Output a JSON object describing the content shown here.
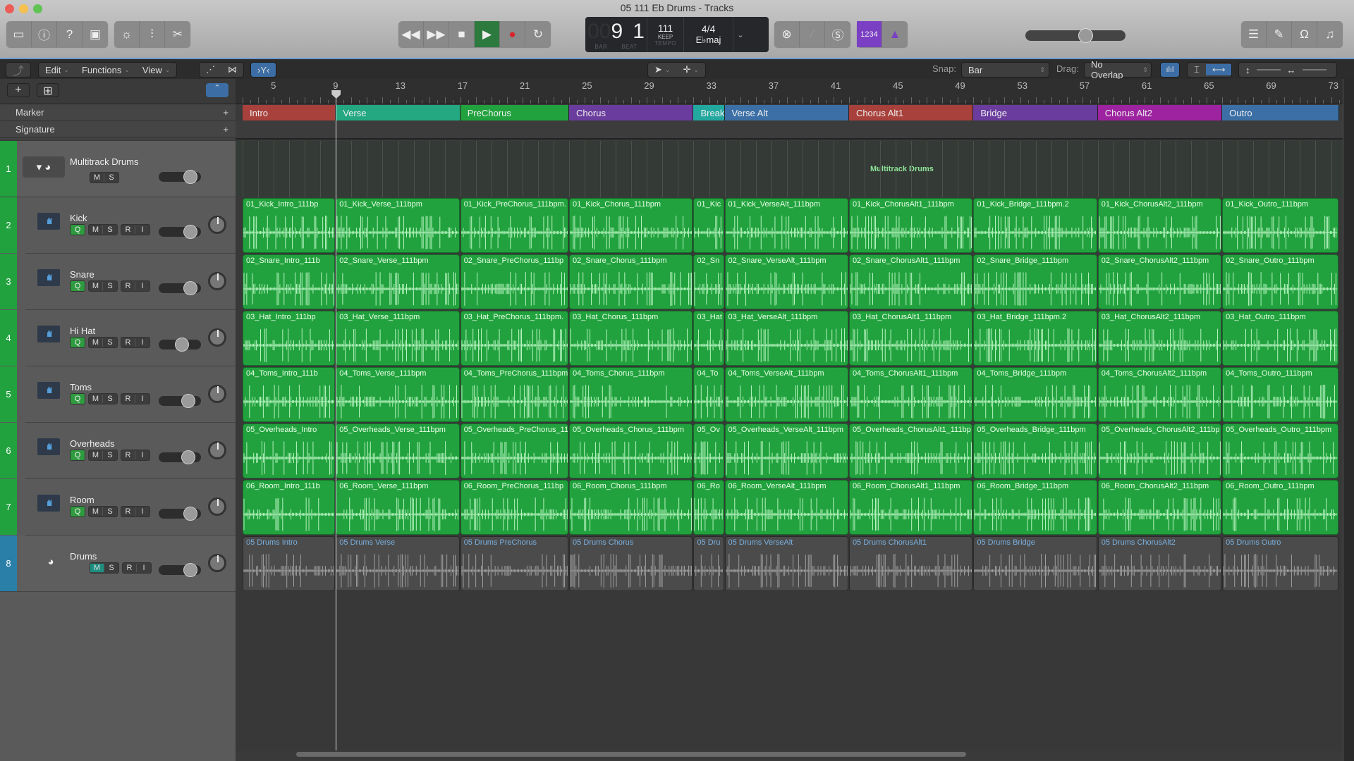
{
  "window": {
    "title": "05 111 Eb Drums - Tracks"
  },
  "toolbar": {
    "left_icons": [
      "library-icon",
      "inspector-icon",
      "quick-help-icon",
      "toolbar-toggle-icon"
    ],
    "mid_icons": [
      "smart-controls-icon",
      "mixer-icon",
      "editors-icon"
    ],
    "transport": [
      "rewind-icon",
      "fast-forward-icon",
      "stop-icon",
      "play-icon",
      "record-icon",
      "cycle-icon"
    ],
    "lcd": {
      "bar": "9",
      "beat": "1",
      "bar_label": "BAR",
      "beat_label": "BEAT",
      "tempo": "111",
      "tempo_mode": "KEEP",
      "tempo_label": "TEMPO",
      "signature": "4/4",
      "key": "E♭maj"
    },
    "right_mid": [
      "replace-icon",
      "tuner-icon",
      "solo-icon"
    ],
    "count_in": "1234",
    "master_volume": 0.6,
    "right_icons": [
      "list-editors-icon",
      "note-pad-icon",
      "loop-browser-icon",
      "browser-icon"
    ]
  },
  "edit_bar": {
    "menus": [
      "Edit",
      "Functions",
      "View"
    ],
    "snap_label": "Snap:",
    "snap_value": "Bar",
    "drag_label": "Drag:",
    "drag_value": "No Overlap"
  },
  "global_tracks": {
    "marker": "Marker",
    "signature": "Signature"
  },
  "ruler": {
    "bars": [
      "5",
      "9",
      "13",
      "17",
      "21",
      "25",
      "29",
      "33",
      "37",
      "41",
      "45",
      "49",
      "53",
      "57",
      "61",
      "65",
      "69",
      "73"
    ]
  },
  "markers": [
    {
      "name": "Intro",
      "color": "#a8403b",
      "start": 3,
      "end": 9
    },
    {
      "name": "Verse",
      "color": "#23a882",
      "start": 9,
      "end": 17
    },
    {
      "name": "PreChorus",
      "color": "#22a23e",
      "start": 17,
      "end": 24
    },
    {
      "name": "Chorus",
      "color": "#6a3c9e",
      "start": 24,
      "end": 32
    },
    {
      "name": "Break",
      "color": "#23a8a0",
      "start": 32,
      "end": 34
    },
    {
      "name": "Verse Alt",
      "color": "#3b6fa6",
      "start": 34,
      "end": 42
    },
    {
      "name": "Chorus Alt1",
      "color": "#a8403b",
      "start": 42,
      "end": 50
    },
    {
      "name": "Bridge",
      "color": "#6a3c9e",
      "start": 50,
      "end": 58
    },
    {
      "name": "Chorus Alt2",
      "color": "#9d23a0",
      "start": 58,
      "end": 66
    },
    {
      "name": "Outro",
      "color": "#3b6fa6",
      "start": 66,
      "end": 73.5
    }
  ],
  "folder": {
    "region_label": "Multitrack Drums"
  },
  "tracks": [
    {
      "num": "1",
      "name": "Multitrack Drums",
      "type": "folder",
      "buttons": [
        "M",
        "S"
      ],
      "volume": 0.75,
      "num_color": "#22a23e"
    },
    {
      "num": "2",
      "name": "Kick",
      "type": "audio",
      "volume": 0.75,
      "num_color": "#22a23e",
      "prefix": "01_Kick_",
      "regions": [
        "01_Kick_Intro_111bp",
        "01_Kick_Verse_111bpm",
        "01_Kick_PreChorus_111bpm.",
        "01_Kick_Chorus_111bpm",
        "01_Kic",
        "01_Kick_VerseAlt_111bpm",
        "01_Kick_ChorusAlt1_111bpm",
        "01_Kick_Bridge_111bpm.2",
        "01_Kick_ChorusAlt2_111bpm",
        "01_Kick_Outro_111bpm"
      ]
    },
    {
      "num": "3",
      "name": "Snare",
      "type": "audio",
      "volume": 0.75,
      "num_color": "#22a23e",
      "regions": [
        "02_Snare_Intro_111b",
        "02_Snare_Verse_111bpm",
        "02_Snare_PreChorus_111bp",
        "02_Snare_Chorus_111bpm",
        "02_Sn",
        "02_Snare_VerseAlt_111bpm",
        "02_Snare_ChorusAlt1_111bpm",
        "02_Snare_Bridge_111bpm",
        "02_Snare_ChorusAlt2_111bpm",
        "02_Snare_Outro_111bpm"
      ]
    },
    {
      "num": "4",
      "name": "Hi Hat",
      "type": "audio",
      "volume": 0.55,
      "num_color": "#22a23e",
      "regions": [
        "03_Hat_Intro_111bp",
        "03_Hat_Verse_111bpm",
        "03_Hat_PreChorus_111bpm.",
        "03_Hat_Chorus_111bpm",
        "03_Hat",
        "03_Hat_VerseAlt_111bpm",
        "03_Hat_ChorusAlt1_111bpm",
        "03_Hat_Bridge_111bpm.2",
        "03_Hat_ChorusAlt2_111bpm",
        "03_Hat_Outro_111bpm"
      ]
    },
    {
      "num": "5",
      "name": "Toms",
      "type": "audio",
      "volume": 0.7,
      "num_color": "#22a23e",
      "regions": [
        "04_Toms_Intro_111b",
        "04_Toms_Verse_111bpm",
        "04_Toms_PreChorus_111bpm",
        "04_Toms_Chorus_111bpm",
        "04_To",
        "04_Toms_VerseAlt_111bpm",
        "04_Toms_ChorusAlt1_111bpm",
        "04_Toms_Bridge_111bpm",
        "04_Toms_ChorusAlt2_111bpm",
        "04_Toms_Outro_111bpm"
      ]
    },
    {
      "num": "6",
      "name": "Overheads",
      "type": "audio",
      "volume": 0.7,
      "num_color": "#22a23e",
      "regions": [
        "05_Overheads_Intro",
        "05_Overheads_Verse_111bpm",
        "05_Overheads_PreChorus_11",
        "05_Overheads_Chorus_111bpm",
        "05_Ov",
        "05_Overheads_VerseAlt_111bpm",
        "05_Overheads_ChorusAlt1_111bp",
        "05_Overheads_Bridge_111bpm",
        "05_Overheads_ChorusAlt2_111bp",
        "05_Overheads_Outro_111bpm"
      ]
    },
    {
      "num": "7",
      "name": "Room",
      "type": "audio",
      "volume": 0.75,
      "num_color": "#22a23e",
      "regions": [
        "06_Room_Intro_111b",
        "06_Room_Verse_111bpm",
        "06_Room_PreChorus_111bp",
        "06_Room_Chorus_111bpm",
        "06_Ro",
        "06_Room_VerseAlt_111bpm",
        "06_Room_ChorusAlt1_111bpm",
        "06_Room_Bridge_111bpm",
        "06_Room_ChorusAlt2_111bpm",
        "06_Room_Outro_111bpm"
      ]
    },
    {
      "num": "8",
      "name": "Drums",
      "type": "drums",
      "volume": 0.75,
      "num_color": "#2a7fa8",
      "muted": true,
      "regions": [
        "05 Drums Intro",
        "05 Drums Verse",
        "05 Drums PreChorus",
        "05 Drums Chorus",
        "05 Dru",
        "05 Drums VerseAlt",
        "05 Drums ChorusAlt1",
        "05 Drums Bridge",
        "05 Drums ChorusAlt2",
        "05 Drums Outro"
      ]
    }
  ],
  "track_buttons": {
    "q": "Q",
    "m": "M",
    "s": "S",
    "r": "R",
    "i": "I"
  },
  "playhead_bar": 9
}
